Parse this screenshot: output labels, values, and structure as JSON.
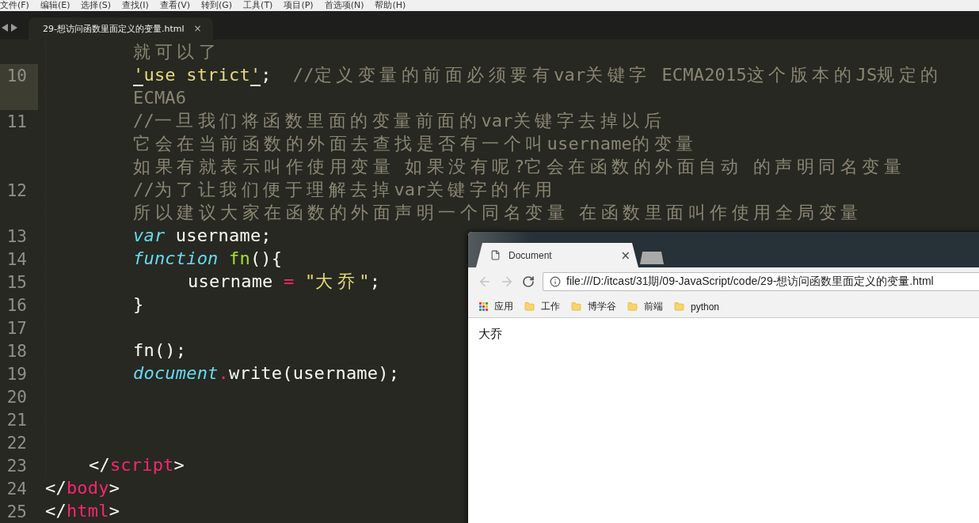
{
  "menu": [
    "文件(F)",
    "编辑(E)",
    "选择(S)",
    "查找(I)",
    "查看(V)",
    "转到(G)",
    "工具(T)",
    "项目(P)",
    "首选项(N)",
    "帮助(H)"
  ],
  "editor": {
    "tab": {
      "title": "29-想访问函数里面定义的变量.html",
      "close": "×"
    },
    "rows": [
      {
        "kind": "code",
        "tokens": [
          {
            "kind": "comment",
            "text": "就可以了"
          }
        ]
      },
      {
        "kind": "code",
        "number": "10",
        "current": true,
        "tokens": [
          {
            "kind": "string",
            "text": "'",
            "underlined": true
          },
          {
            "kind": "string",
            "text": "use strict"
          },
          {
            "kind": "string",
            "text": "'",
            "underlined": true
          },
          {
            "kind": "plain",
            "text": ";  "
          },
          {
            "kind": "comment",
            "text": "//定义变量的前面必须要有var关键字 ECMA2015这个版本的JS规定的"
          }
        ]
      },
      {
        "kind": "code",
        "current": true,
        "tokens": [
          {
            "kind": "comment",
            "text": "ECMA6"
          }
        ]
      },
      {
        "kind": "code",
        "number": "11",
        "current": false,
        "tokens": [
          {
            "kind": "comment",
            "text": "//一旦我们将函数里面的变量前面的var关键字去掉以后"
          }
        ]
      },
      {
        "kind": "code",
        "tokens": [
          {
            "kind": "comment",
            "text": "它会在当前函数的外面去查找是否有一个叫username的变量"
          }
        ]
      },
      {
        "kind": "code",
        "tokens": [
          {
            "kind": "comment",
            "text": "如果有就表示叫作使用变量 如果没有呢?它会在函数的外面自动 的声明同名变量"
          }
        ]
      },
      {
        "kind": "code",
        "number": "12",
        "current": false,
        "tokens": [
          {
            "kind": "comment",
            "text": "//为了让我们便于理解去掉var关键字的作用"
          }
        ]
      },
      {
        "kind": "code",
        "tokens": [
          {
            "kind": "comment",
            "text": "所以建议大家在函数的外面声明一个同名变量 在函数里面叫作使用全局变量"
          }
        ]
      },
      {
        "kind": "code",
        "number": "13",
        "current": false,
        "tokens": [
          {
            "kind": "storage",
            "text": "var"
          },
          {
            "kind": "plain",
            "text": " username;"
          }
        ]
      },
      {
        "kind": "code",
        "number": "14",
        "current": false,
        "tokens": [
          {
            "kind": "storage",
            "text": "function"
          },
          {
            "kind": "entity",
            "text": " fn"
          },
          {
            "kind": "plain",
            "text": "(){"
          }
        ]
      },
      {
        "kind": "nested",
        "number": "15",
        "current": false,
        "tokens": [
          {
            "kind": "plain",
            "text": "username "
          },
          {
            "kind": "operator",
            "text": "="
          },
          {
            "kind": "string",
            "text": " \"大乔\""
          },
          {
            "kind": "plain",
            "text": ";"
          }
        ]
      },
      {
        "kind": "code",
        "number": "16",
        "current": false,
        "tokens": [
          {
            "kind": "plain",
            "text": "}"
          }
        ]
      },
      {
        "kind": "code",
        "number": "17",
        "current": false,
        "tokens": []
      },
      {
        "kind": "code",
        "number": "18",
        "current": false,
        "tokens": [
          {
            "kind": "plain",
            "text": "fn();"
          }
        ]
      },
      {
        "kind": "code",
        "number": "19",
        "current": false,
        "tokens": [
          {
            "kind": "support",
            "text": "document"
          },
          {
            "kind": "operator",
            "text": "."
          },
          {
            "kind": "plain",
            "text": "write(username);"
          }
        ]
      },
      {
        "kind": "code",
        "number": "20",
        "current": false,
        "tokens": []
      },
      {
        "kind": "code",
        "number": "21",
        "current": false,
        "tokens": []
      },
      {
        "kind": "code",
        "number": "22",
        "current": false,
        "tokens": []
      },
      {
        "kind": "tag",
        "number": "23",
        "current": false,
        "tokens": [
          {
            "kind": "plain",
            "text": "</"
          },
          {
            "kind": "operator",
            "text": "script"
          },
          {
            "kind": "plain",
            "text": ">"
          }
        ]
      },
      {
        "kind": "top",
        "number": "24",
        "current": false,
        "tokens": [
          {
            "kind": "plain",
            "text": "</"
          },
          {
            "kind": "operator",
            "text": "body"
          },
          {
            "kind": "plain",
            "text": ">"
          }
        ]
      },
      {
        "kind": "top",
        "number": "25",
        "current": false,
        "tokens": [
          {
            "kind": "plain",
            "text": "</"
          },
          {
            "kind": "operator",
            "text": "html"
          },
          {
            "kind": "plain",
            "text": ">"
          }
        ]
      }
    ]
  },
  "browser": {
    "tabs": [
      {
        "title": "Document",
        "close": "×",
        "selected": true
      },
      {
        "selected": false
      }
    ],
    "back": {
      "disabled": true
    },
    "forward": {
      "disabled": true
    },
    "address": {
      "value": "file:///D:/itcast/31期/09-JavaScript/code/29-想访问函数里面定义的变量.html"
    },
    "bookmarks": [
      {
        "kind": "apps",
        "label": "应用"
      },
      {
        "kind": "folder",
        "label": "工作"
      },
      {
        "kind": "folder",
        "label": "博学谷"
      },
      {
        "kind": "folder",
        "label": "前端"
      },
      {
        "kind": "folder",
        "label": "python"
      }
    ],
    "content": "大乔"
  }
}
